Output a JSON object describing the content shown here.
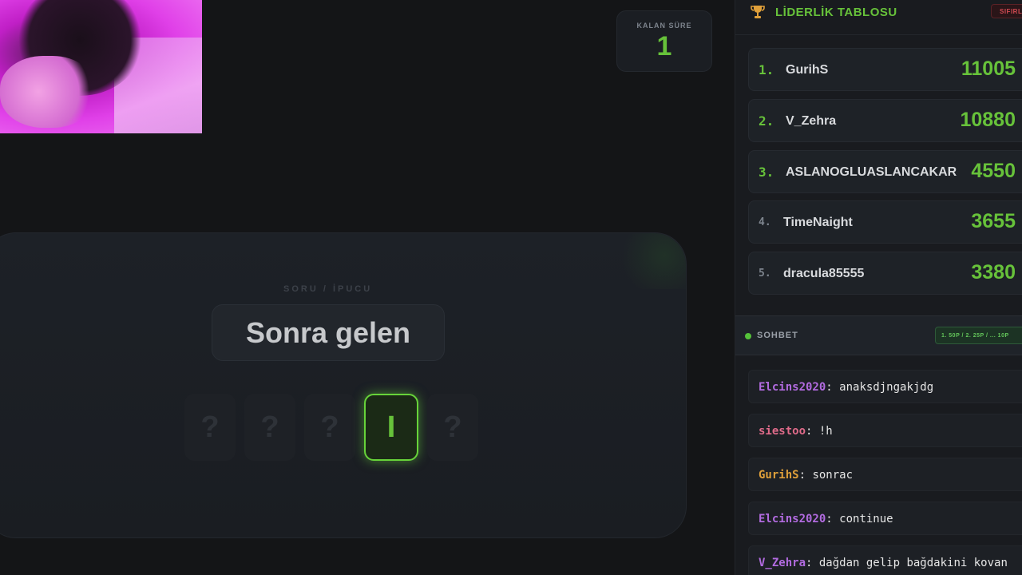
{
  "timer": {
    "label": "KALAN SÜRE",
    "value": "1"
  },
  "game": {
    "hint_label": "SORU / İPUCU",
    "hint": "Sonra gelen",
    "tiles": [
      "?",
      "?",
      "?",
      "I",
      "?"
    ]
  },
  "leaderboard": {
    "title": "LİDERLİK TABLOSU",
    "reset_label": "SIFIRLA",
    "rows": [
      {
        "rank": "1.",
        "name": "GurihS",
        "score": "11005"
      },
      {
        "rank": "2.",
        "name": "V_Zehra",
        "score": "10880"
      },
      {
        "rank": "3.",
        "name": "ASLANOGLUASLANCAKAR",
        "score": "4550"
      },
      {
        "rank": "4.",
        "name": "TimeNaight",
        "score": "3655"
      },
      {
        "rank": "5.",
        "name": "dracula85555",
        "score": "3380"
      }
    ]
  },
  "chat": {
    "title": "SOHBET",
    "pill": "1. 50P / 2. 25P / ... 10P",
    "messages": [
      {
        "user": "Elcins2020",
        "text": "anaksdjngakjdg"
      },
      {
        "user": "siestoo",
        "text": "!h"
      },
      {
        "user": "GurihS",
        "text": "sonrac"
      },
      {
        "user": "Elcins2020",
        "text": "continue"
      },
      {
        "user": "V_Zehra",
        "text": "dağdan gelip bağdakini kovan"
      }
    ]
  },
  "colors": {
    "accent": "#67c23a",
    "rank_top": "#67c23a",
    "rank_other": "#7d848d",
    "user_purple": "#b26be0",
    "user_pink": "#e06b8a",
    "user_orange": "#e0a03a"
  }
}
